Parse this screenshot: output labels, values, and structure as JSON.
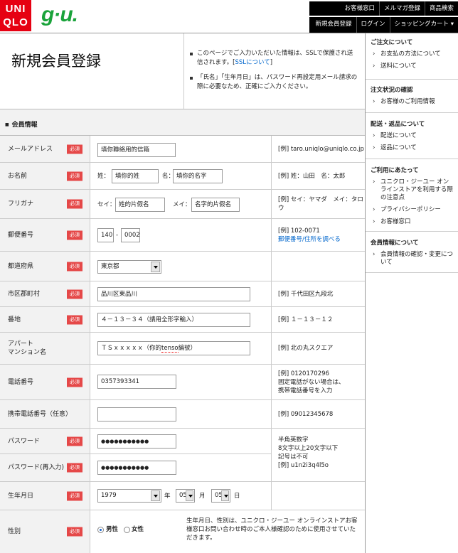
{
  "header": {
    "logo_uniqlo_line1": "UNI",
    "logo_uniqlo_line2": "QLO",
    "logo_gu": "g·u.",
    "nav_top": [
      "お客様窓口",
      "メルマガ登録",
      "商品検索"
    ],
    "nav_bottom": [
      "新規会員登録",
      "ログイン",
      "ショッピングカート ▾"
    ]
  },
  "page": {
    "title": "新規会員登録",
    "notice_1_pre": "このページでご入力いただいた情報は、SSLで保護され送信されます。[",
    "notice_1_link": "SSLについて",
    "notice_1_post": "]",
    "notice_2": "「氏名」「生年月日」は、パスワード再設定用メール請求の際に必要なため、正確にご入力ください。"
  },
  "form": {
    "section_title": "会員情報",
    "required_badge": "必須",
    "rows": {
      "email": {
        "label": "メールアドレス",
        "value": "填你聯絡用的信箱",
        "example": "[例] taro.uniqlo@uniqlo.co.jp"
      },
      "name": {
        "label": "お名前",
        "sei_label": "姓：",
        "sei_value": "填你的姓",
        "mei_label": "名：",
        "mei_value": "填你的名字",
        "example": "[例] 姓：山田　名：太郎"
      },
      "furigana": {
        "label": "フリガナ",
        "sei_label": "セイ：",
        "sei_value": "姓的片假名",
        "mei_label": "メイ：",
        "mei_value": "名字的片假名",
        "example": "[例] セイ：ヤマダ　メイ：タロウ"
      },
      "postal": {
        "label": "郵便番号",
        "value1": "140",
        "dash": "-",
        "value2": "0002",
        "example": "[例] 102-0071",
        "example_link": "郵便番号/住所を調べる"
      },
      "prefecture": {
        "label": "都道府県",
        "value": "東京都"
      },
      "city": {
        "label": "市区郡町村",
        "value": "品川区東品川",
        "example": "[例] 千代田区九段北"
      },
      "address": {
        "label": "番地",
        "value": "４－１３－３４（請用全形字輸入）",
        "example": "[例] １－１３－１２"
      },
      "apartment": {
        "label_1": "アパート",
        "label_2": "マンション名",
        "value_pre": "ＴＳｘｘｘｘｘ（你的",
        "value_mid": "tenso",
        "value_post": "編號）",
        "example": "[例] 北の丸スクエア"
      },
      "phone": {
        "label": "電話番号",
        "value": "0357393341",
        "example_1": "[例] 0120170296",
        "example_2": "固定電話がない場合は、",
        "example_3": "携帯電話番号を入力"
      },
      "mobile": {
        "label": "携帯電話番号（任意）",
        "value": "",
        "example": "[例] 09012345678"
      },
      "password": {
        "label": "パスワード",
        "value": "●●●●●●●●●●●"
      },
      "password_confirm": {
        "label": "パスワード(再入力)",
        "value": "●●●●●●●●●●●"
      },
      "password_rules": [
        "半角英数字",
        "8文字以上20文字以下",
        "記号は不可",
        "[例] u1n2i3q4l5o"
      ],
      "birthday": {
        "label": "生年月日",
        "year": "1979",
        "year_unit": "年",
        "month": "05",
        "month_unit": "月",
        "day": "05",
        "day_unit": "日"
      },
      "gender": {
        "label": "性別",
        "male": "男性",
        "female": "女性",
        "note": "生年月日、性別は、ユニクロ・ジーユー オンラインストアお客様窓口お問い合わせ時のご本人様確認のために使用させていただきます。"
      }
    }
  },
  "sidebar": {
    "sections": [
      {
        "heading": "ご注文について",
        "items": [
          "お支払の方法について",
          "送料について"
        ]
      },
      {
        "heading": "注文状況の確認",
        "items": [
          "お客様のご利用情報"
        ]
      },
      {
        "heading": "配送・返品について",
        "items": [
          "配送について",
          "返品について"
        ]
      },
      {
        "heading": "ご利用にあたって",
        "items": [
          "ユニクロ・ジーユー オンラインストアを利用する際の注意点",
          "プライバシーポリシー",
          "お客様窓口"
        ]
      },
      {
        "heading": "会員情報について",
        "items": [
          "会員情報の確認・変更について"
        ]
      }
    ]
  },
  "colors": {
    "uniqlo_red": "#e60012",
    "gu_green": "#1aa33b",
    "required_red": "#e54848",
    "link_blue": "#0066cc"
  }
}
